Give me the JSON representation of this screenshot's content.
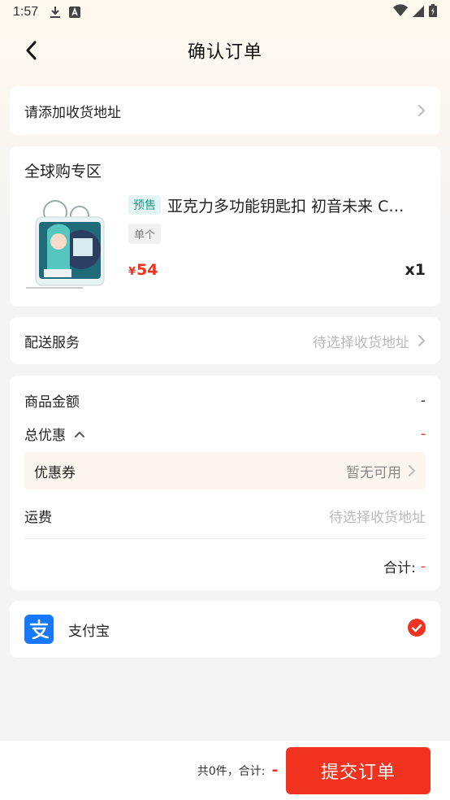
{
  "status_bar": {
    "time": "1:57"
  },
  "header": {
    "title": "确认订单"
  },
  "address": {
    "label": "请添加收货地址"
  },
  "product_section": {
    "zone_title": "全球购专区",
    "product": {
      "tag": "预售",
      "name": "亚克力多功能钥匙扣 初音未来 C…",
      "spec": "单个",
      "currency": "¥",
      "price": "54",
      "quantity": "x1"
    }
  },
  "delivery": {
    "label": "配送服务",
    "value": "待选择收货地址"
  },
  "price_detail": {
    "goods_amount_label": "商品金额",
    "goods_amount_value": "-",
    "discount_label": "总优惠",
    "discount_value": "-",
    "coupon_label": "优惠券",
    "coupon_value": "暂无可用",
    "shipping_label": "运费",
    "shipping_value": "待选择收货地址",
    "total_label": "合计:",
    "total_value": "-"
  },
  "payment": {
    "method": "支付宝"
  },
  "footer": {
    "summary": "共0件，合计:",
    "total": "-",
    "submit_label": "提交订单"
  },
  "colors": {
    "accent": "#f0321e",
    "alipay": "#1677ff",
    "presale_tag": "#1a9e8a"
  }
}
